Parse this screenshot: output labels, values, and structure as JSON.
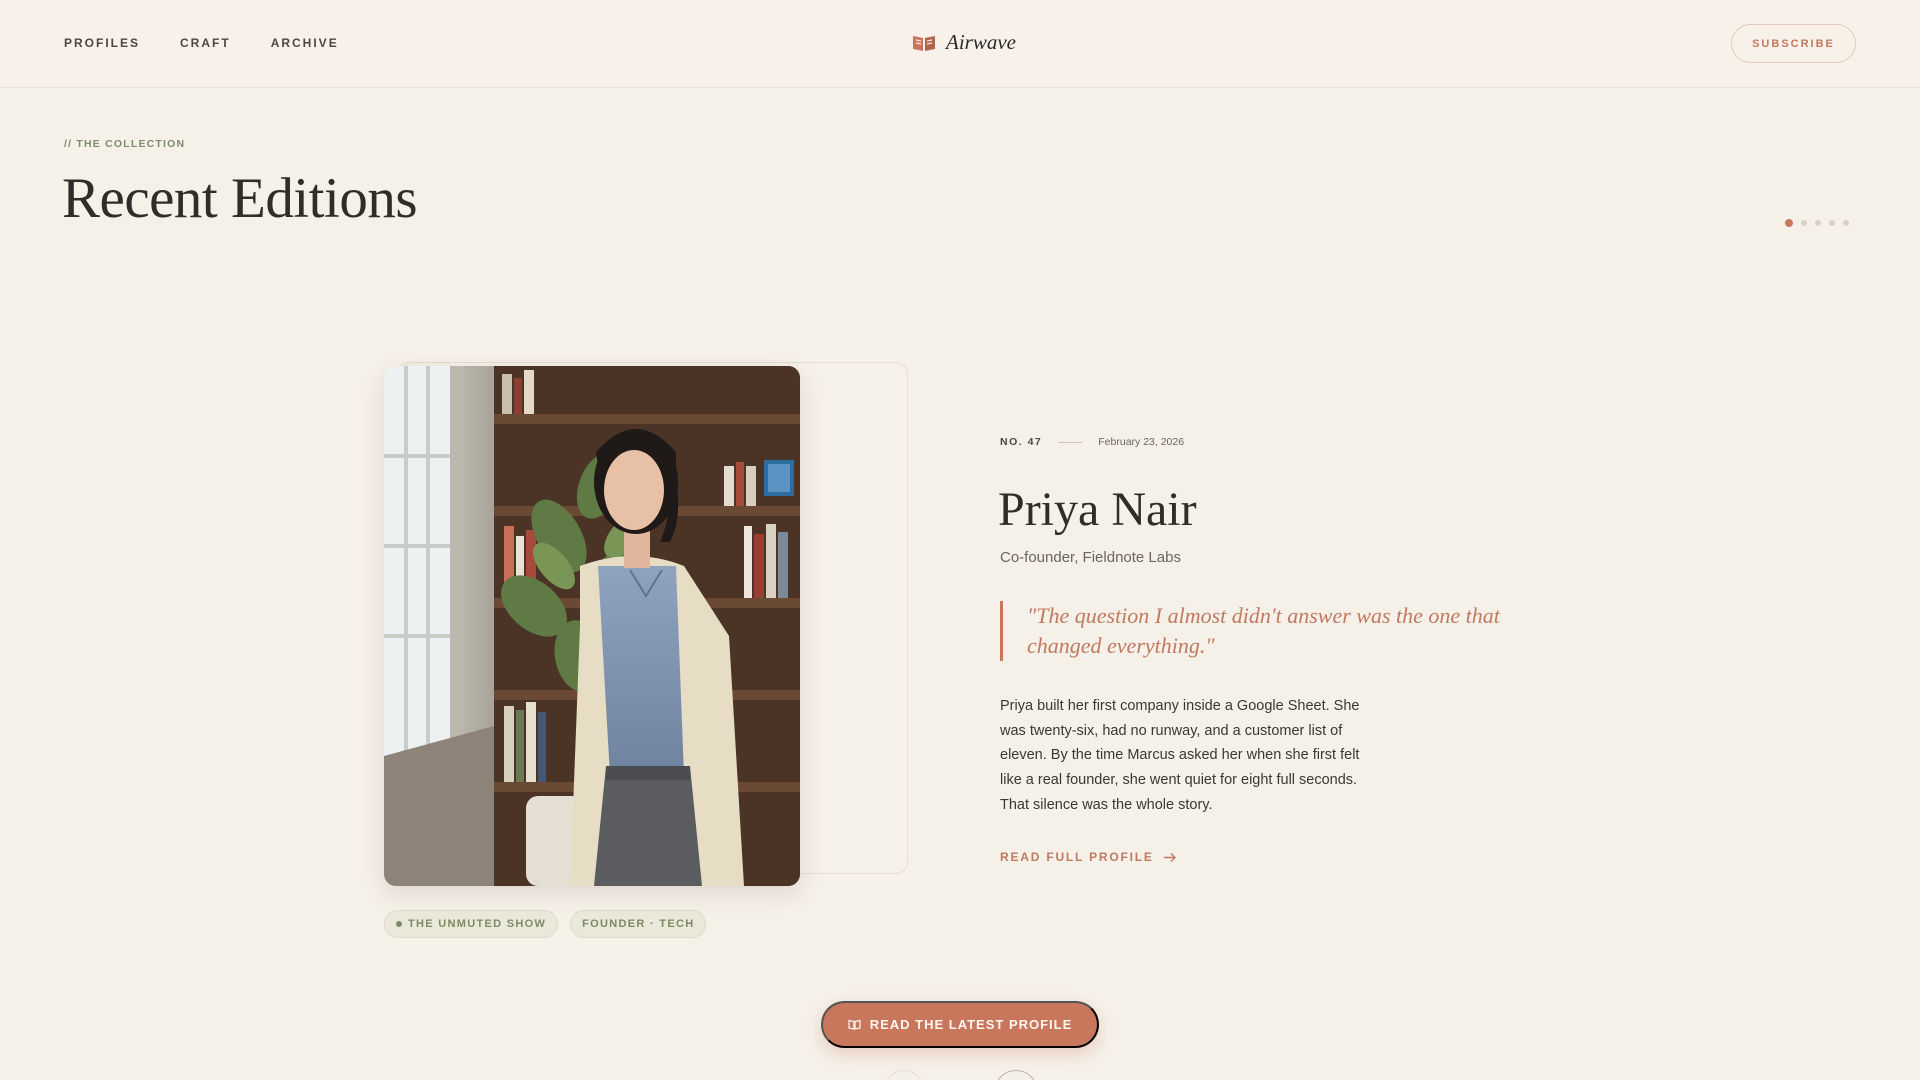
{
  "header": {
    "nav": [
      "PROFILES",
      "CRAFT",
      "ARCHIVE"
    ],
    "brand": "Airwave",
    "subscribe_label": "SUBSCRIBE"
  },
  "section": {
    "eyebrow": "// THE COLLECTION",
    "title": "Recent Editions",
    "pager": {
      "total": 5,
      "active_index": 0
    }
  },
  "profile": {
    "issue": "NO. 47",
    "date": "February 23, 2026",
    "name": "Priya Nair",
    "role": "Co-founder, Fieldnote Labs",
    "quote": "\"The question I almost didn't answer was the one that changed everything.\"",
    "body": "Priya built her first company inside a Google Sheet. She was twenty-six, had no runway, and a customer list of eleven. By the time Marcus asked her when she first felt like a real founder, she went quiet for eight full seconds. That silence was the whole story.",
    "read_link": "READ FULL PROFILE",
    "tags": [
      "THE UNMUTED SHOW",
      "FOUNDER · TECH"
    ]
  },
  "cta_label": "READ THE LATEST PROFILE",
  "colors": {
    "background": "#f5f0e8",
    "accent": "#c8775d",
    "sage": "#7c8a66",
    "ink": "#2f2d2a"
  },
  "icons": {
    "brand": "book-logo-icon",
    "link": "arrow-right-icon",
    "cta": "open-book-icon"
  }
}
